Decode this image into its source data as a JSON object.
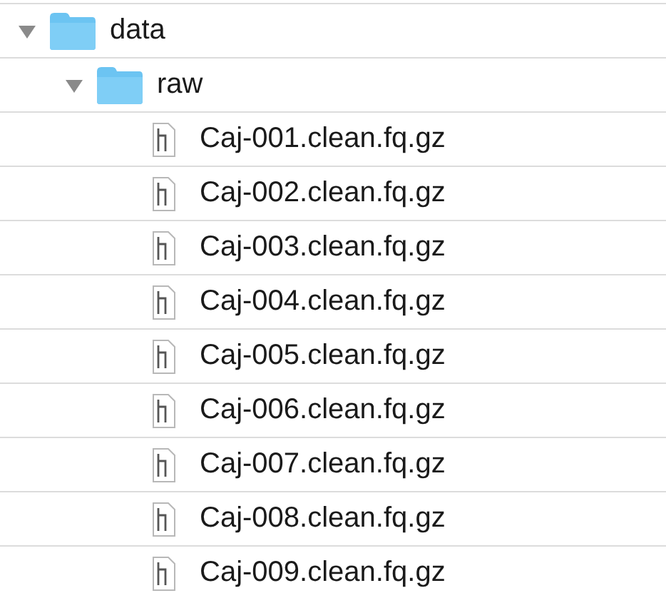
{
  "tree": [
    {
      "kind": "folder",
      "name": "data",
      "expanded": true,
      "children": [
        {
          "kind": "folder",
          "name": "raw",
          "expanded": true,
          "children": [
            {
              "kind": "file",
              "name": "Caj-001.clean.fq.gz"
            },
            {
              "kind": "file",
              "name": "Caj-002.clean.fq.gz"
            },
            {
              "kind": "file",
              "name": "Caj-003.clean.fq.gz"
            },
            {
              "kind": "file",
              "name": "Caj-004.clean.fq.gz"
            },
            {
              "kind": "file",
              "name": "Caj-005.clean.fq.gz"
            },
            {
              "kind": "file",
              "name": "Caj-006.clean.fq.gz"
            },
            {
              "kind": "file",
              "name": "Caj-007.clean.fq.gz"
            },
            {
              "kind": "file",
              "name": "Caj-008.clean.fq.gz"
            },
            {
              "kind": "file",
              "name": "Caj-009.clean.fq.gz"
            }
          ]
        }
      ]
    }
  ]
}
